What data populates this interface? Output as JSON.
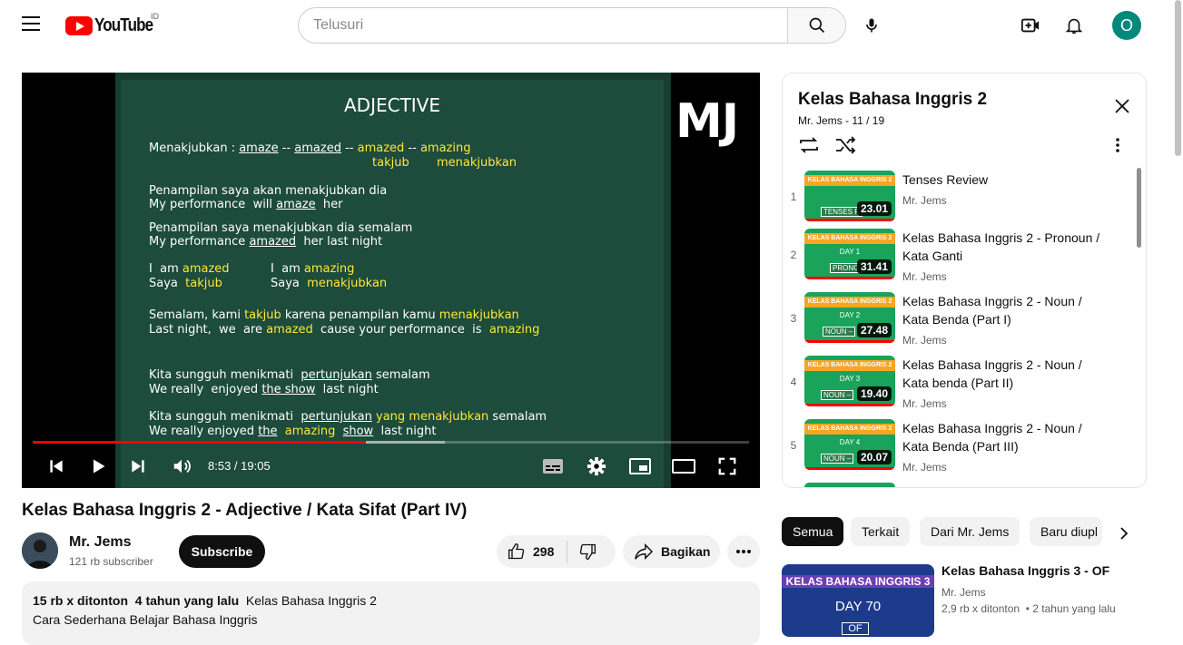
{
  "header": {
    "logo_text": "YouTube",
    "country_code": "ID",
    "search_placeholder": "Telusuri",
    "avatar_letter": "O"
  },
  "player": {
    "slide": {
      "title": "ADJECTIVE",
      "watermark": "MJ",
      "lines": {
        "l1a": "Menakjubkan : ",
        "l1b": "amaze",
        "l1c": " -- ",
        "l1d": "amazed",
        "l1e": " -- ",
        "l1f": "amazed",
        "l1g": " -- ",
        "l1h": "amazing",
        "l2a": "takjub",
        "l2b": "menakjubkan",
        "l3": "Penampilan saya akan menakjubkan dia",
        "l4a": "My performance  will ",
        "l4b": "amaze",
        "l4c": "  her",
        "l5": "Penampilan saya menakjubkan dia semalam",
        "l6a": "My performance ",
        "l6b": "amazed",
        "l6c": "  her last night",
        "l7a": "I  am ",
        "l7b": "amazed",
        "l7c": "I  am ",
        "l7d": "amazing",
        "l8a": "Saya  ",
        "l8b": "takjub",
        "l8c": "Saya  ",
        "l8d": "menakjubkan",
        "l9a": "Semalam, kami ",
        "l9b": "takjub",
        "l9c": " karena penampilan kamu ",
        "l9d": "menakjubkan",
        "l10a": "Last night,  we  are ",
        "l10b": "amazed",
        "l10c": "  cause your performance  is  ",
        "l10d": "amazing",
        "l11a": "Kita sungguh menikmati  ",
        "l11b": "pertunjukan",
        "l11c": " semalam",
        "l12a": "We really  enjoyed ",
        "l12b": "the show",
        "l12c": "  last night",
        "l13a": "Kita sungguh menikmati  ",
        "l13b": "pertunjukan",
        "l13c": " yang menakjubkan",
        "l13d": " semalam",
        "l14a": "We really enjoyed ",
        "l14b": "the",
        "l14c": "  amazing  ",
        "l14d": "show",
        "l14e": "  last night"
      }
    },
    "time_current": "8:53",
    "time_total": "19:05",
    "time_display": "8:53 / 19:05",
    "progress_played": 0.465,
    "progress_buffered": 0.575
  },
  "video": {
    "title": "Kelas Bahasa Inggris 2 - Adjective / Kata Sifat (Part IV)",
    "channel": "Mr. Jems",
    "subscribers": "121 rb subscriber",
    "subscribe_label": "Subscribe",
    "likes": "298",
    "share_label": "Bagikan",
    "description": {
      "views": "15 rb x ditonton",
      "age": "4 tahun yang lalu",
      "playlist": "Kelas Bahasa Inggris 2",
      "text": "Cara Sederhana Belajar Bahasa Inggris"
    }
  },
  "playlist": {
    "title": "Kelas Bahasa Inggris 2",
    "subtitle": "Mr. Jems - 11 / 19",
    "items": [
      {
        "index": "1",
        "title": "Tenses Review",
        "channel": "Mr. Jems",
        "duration": "23.01",
        "band": "KELAS BAHASA INGGRIS 2",
        "day": "",
        "tag": "TENSES R"
      },
      {
        "index": "2",
        "title": "Kelas Bahasa Inggris 2 - Pronoun / Kata Ganti",
        "channel": "Mr. Jems",
        "duration": "31.41",
        "band": "KELAS BAHASA INGGRIS 2",
        "day": "DAY 1",
        "tag": "PRONO"
      },
      {
        "index": "3",
        "title": "Kelas Bahasa Inggris 2 - Noun / Kata Benda (Part I)",
        "channel": "Mr. Jems",
        "duration": "27.48",
        "band": "KELAS BAHASA INGGRIS 2",
        "day": "DAY 2",
        "tag": "NOUN –"
      },
      {
        "index": "4",
        "title": "Kelas Bahasa Inggris 2 - Noun / Kata benda (Part II)",
        "channel": "Mr. Jems",
        "duration": "19.40",
        "band": "KELAS BAHASA INGGRIS 2",
        "day": "DAY 3",
        "tag": "NOUN –"
      },
      {
        "index": "5",
        "title": "Kelas Bahasa Inggris 2 - Noun / Kata Benda (Part III)",
        "channel": "Mr. Jems",
        "duration": "20.07",
        "band": "KELAS BAHASA INGGRIS 2",
        "day": "DAY 4",
        "tag": "NOUN –"
      }
    ]
  },
  "chips": [
    "Semua",
    "Terkait",
    "Dari Mr. Jems",
    "Baru diupl"
  ],
  "related": {
    "title": "Kelas Bahasa Inggris 3 - OF",
    "channel": "Mr. Jems",
    "views": "2,9 rb x ditonton",
    "age": "2 tahun yang lalu",
    "thumb_band": "KELAS BAHASA INGGRIS 3",
    "thumb_day": "DAY 70",
    "thumb_tag": "OF"
  },
  "colors": {
    "brand_red": "#ff0000",
    "board_green": "#1d4b3c",
    "slide_yellow": "#ffe739",
    "avatar_teal": "#00897b"
  }
}
